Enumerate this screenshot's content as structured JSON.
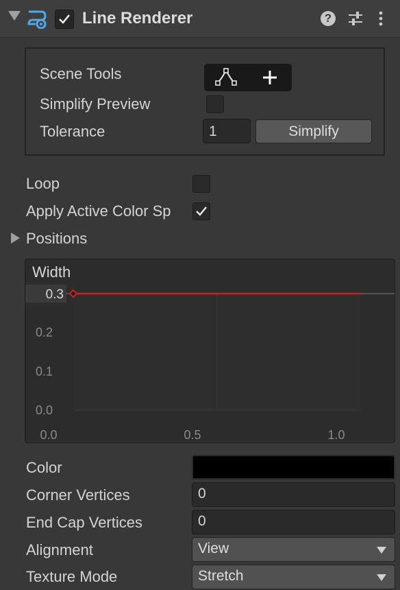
{
  "component": {
    "title": "Line Renderer",
    "enabled": true,
    "icons": {
      "component": "line-renderer-icon",
      "help": "help-icon",
      "presets": "presets-icon",
      "menu": "kebab-menu-icon"
    },
    "help_glyph": "?"
  },
  "scene_tools": {
    "label": "Scene Tools",
    "buttons": [
      "edit-points-icon",
      "add-points-icon"
    ],
    "simplify_preview_label": "Simplify Preview",
    "simplify_preview_checked": false,
    "tolerance_label": "Tolerance",
    "tolerance_value": "1",
    "simplify_button": "Simplify"
  },
  "loop": {
    "label": "Loop",
    "checked": false
  },
  "apply_active_color_space": {
    "label": "Apply Active Color Sp",
    "checked": true
  },
  "positions": {
    "label": "Positions",
    "expanded": false
  },
  "width_curve": {
    "label": "Width",
    "current_value": "0.3",
    "curve_color": "#d21e1e"
  },
  "chart_data": {
    "type": "line",
    "title": "Width",
    "x": [
      0.0,
      1.0
    ],
    "series": [
      {
        "values": [
          0.3,
          0.3
        ]
      }
    ],
    "xlim": [
      0.0,
      1.0
    ],
    "ylim": [
      0.0,
      0.3
    ],
    "x_ticks": [
      "0.0",
      "0.5",
      "1.0"
    ],
    "y_ticks": [
      "0.0",
      "0.1",
      "0.2"
    ],
    "key_label": "0.3",
    "grid": true
  },
  "properties": {
    "color": {
      "label": "Color",
      "value_hex": "#000000"
    },
    "corner_vertices": {
      "label": "Corner Vertices",
      "value": "0"
    },
    "end_cap_vertices": {
      "label": "End Cap Vertices",
      "value": "0"
    },
    "alignment": {
      "label": "Alignment",
      "value": "View"
    },
    "texture_mode": {
      "label": "Texture Mode",
      "value": "Stretch"
    }
  }
}
